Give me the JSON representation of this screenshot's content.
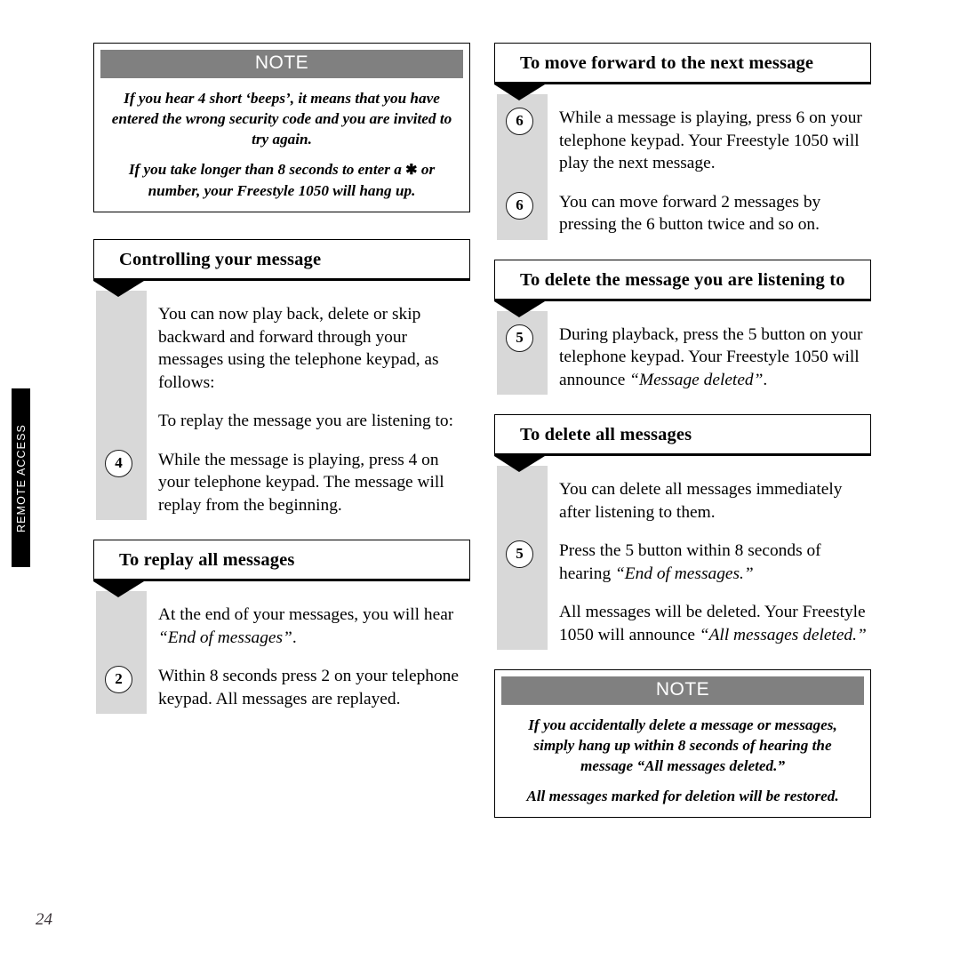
{
  "page": {
    "number": "24",
    "side_tab_label": "REMOTE ACCESS",
    "note_heading": "NOTE",
    "colors": {
      "note_header_bg": "#808080",
      "gray_bar": "#d8d8d8",
      "side_tab_bg": "#000000",
      "text": "#000000"
    }
  },
  "left_column": {
    "note_top": {
      "heading": "NOTE",
      "paragraphs": [
        "If you hear 4 short ‘beeps’, it means that you have entered the wrong security code and you are invited to try again.",
        "If you take longer than 8 seconds to enter a ✱ or number, your Freestyle 1050 will hang up."
      ],
      "paragraph2_before_symbol": "If you take longer than 8 seconds to enter a ",
      "symbol": "✱",
      "paragraph2_after_symbol": " or number, your Freestyle 1050 will hang up."
    },
    "section_controlling": {
      "title": "Controlling your message",
      "steps": [
        {
          "badge": "",
          "text": "You can now play back, delete or skip backward and forward through your messages using the telephone keypad, as follows:"
        },
        {
          "badge": "",
          "text": "To replay the message you are listening to:"
        },
        {
          "badge": "4",
          "text": "While the message is playing, press 4 on your telephone keypad. The message will replay from the beginning."
        }
      ]
    },
    "section_replay_all": {
      "title": "To replay all messages",
      "steps": [
        {
          "badge": "",
          "text_before": "At the end of your messages, you will hear ",
          "italic": "“End of messages”",
          "text_after": "."
        },
        {
          "badge": "2",
          "text": "Within 8 seconds press 2 on your telephone keypad. All messages are replayed."
        }
      ]
    }
  },
  "right_column": {
    "section_move_forward": {
      "title": "To move forward to the next message",
      "steps": [
        {
          "badge": "6",
          "text": "While a message is playing, press 6 on your telephone keypad. Your Freestyle 1050 will play the next message."
        },
        {
          "badge": "6",
          "text": "You can move forward 2 messages by pressing the 6 button twice and so on."
        }
      ]
    },
    "section_delete_one": {
      "title": "To delete the message you are listening to",
      "steps": [
        {
          "badge": "5",
          "text_before": "During playback, press the 5 button on your telephone keypad. Your Freestyle 1050 will announce ",
          "italic": "“Message deleted”",
          "text_after": "."
        }
      ]
    },
    "section_delete_all": {
      "title": "To delete all messages",
      "steps": [
        {
          "badge": "",
          "text": "You can delete all messages immediately after listening to them."
        },
        {
          "badge": "5",
          "text_before": "Press the 5 button within 8 seconds of hearing ",
          "italic": "“End of messages.”",
          "text_after": ""
        },
        {
          "badge": "",
          "text_before": "All messages will be deleted. Your Freestyle 1050 will announce ",
          "italic": "“All messages deleted.”",
          "text_after": ""
        }
      ]
    },
    "note_bottom": {
      "heading": "NOTE",
      "paragraphs": [
        "If you accidentally delete a message or messages, simply hang up within 8 seconds of hearing the message “All messages deleted.”",
        "All messages marked for deletion will be restored."
      ]
    }
  }
}
